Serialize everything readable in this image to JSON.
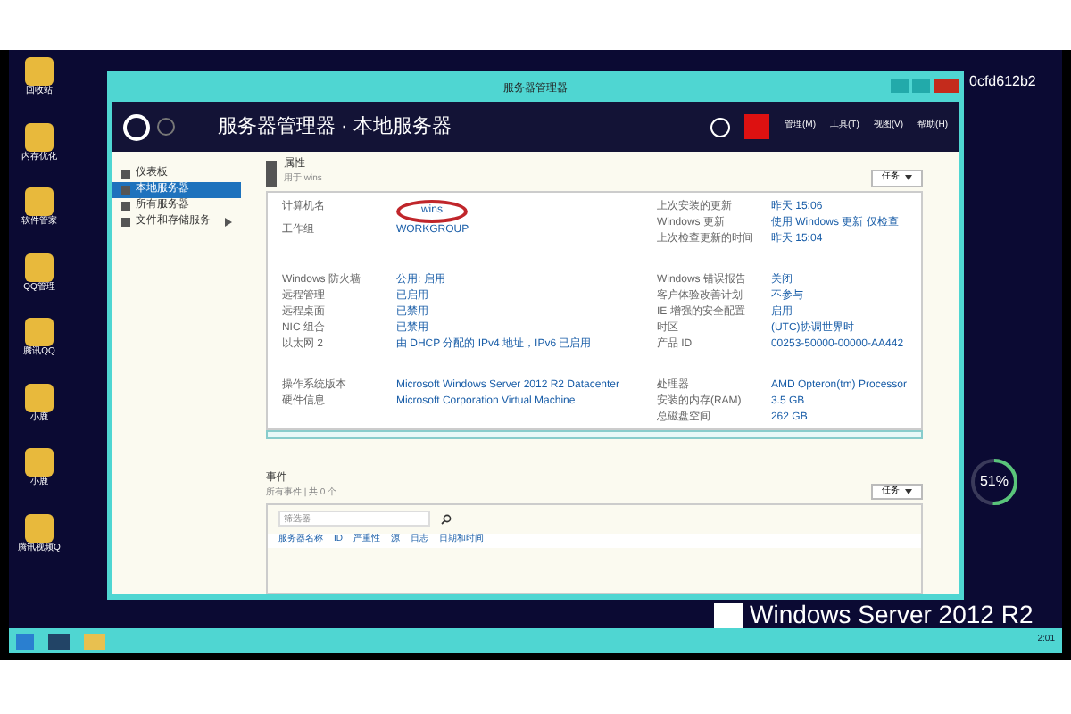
{
  "desktop_icons": [
    {
      "label": "回收站"
    },
    {
      "label": "内存优化"
    },
    {
      "label": "软件管家"
    },
    {
      "label": "QQ管理"
    },
    {
      "label": "腾讯QQ"
    },
    {
      "label": "小鹿"
    },
    {
      "label": "小鹿"
    },
    {
      "label": "腾讯视频Q"
    }
  ],
  "desktop_label": "0cfd612b2",
  "window": {
    "title": "服务器管理器"
  },
  "header": {
    "breadcrumb": "服务器管理器 · 本地服务器",
    "menu": [
      "管理(M)",
      "工具(T)",
      "视图(V)",
      "帮助(H)"
    ]
  },
  "sidebar": {
    "items": [
      {
        "label": "仪表板",
        "selected": false,
        "expandable": false
      },
      {
        "label": "本地服务器",
        "selected": true,
        "expandable": false
      },
      {
        "label": "所有服务器",
        "selected": false,
        "expandable": false
      },
      {
        "label": "文件和存储服务",
        "selected": false,
        "expandable": true
      }
    ]
  },
  "properties": {
    "title": "属性",
    "subtitle": "用于 wins",
    "tasks_button": "任务",
    "groups": [
      {
        "left": [
          {
            "label": "计算机名",
            "value": "wins",
            "highlighted": true
          },
          {
            "label": "工作组",
            "value": "WORKGROUP",
            "highlighted": false
          }
        ],
        "right": [
          {
            "label": "上次安装的更新",
            "value": "昨天 15:06"
          },
          {
            "label": "Windows 更新",
            "value": "使用 Windows 更新 仅检查"
          },
          {
            "label": "上次检查更新的时间",
            "value": "昨天 15:04"
          }
        ]
      },
      {
        "left": [
          {
            "label": "Windows 防火墙",
            "value": "公用: 启用",
            "highlighted": false
          },
          {
            "label": "远程管理",
            "value": "已启用",
            "highlighted": false
          },
          {
            "label": "远程桌面",
            "value": "已禁用",
            "highlighted": false
          },
          {
            "label": "NIC 组合",
            "value": "已禁用",
            "highlighted": false
          },
          {
            "label": "以太网 2",
            "value": "由 DHCP 分配的 IPv4 地址，IPv6 已启用",
            "highlighted": false
          }
        ],
        "right": [
          {
            "label": "Windows 错误报告",
            "value": "关闭"
          },
          {
            "label": "客户体验改善计划",
            "value": "不参与"
          },
          {
            "label": "IE 增强的安全配置",
            "value": "启用"
          },
          {
            "label": "时区",
            "value": "(UTC)协调世界时"
          },
          {
            "label": "产品 ID",
            "value": "00253-50000-00000-AA442"
          }
        ]
      },
      {
        "left": [
          {
            "label": "操作系统版本",
            "value": "Microsoft Windows Server 2012 R2 Datacenter",
            "highlighted": false
          },
          {
            "label": "硬件信息",
            "value": "Microsoft Corporation Virtual Machine",
            "highlighted": false
          }
        ],
        "right": [
          {
            "label": "处理器",
            "value": "AMD Opteron(tm) Processor"
          },
          {
            "label": "安装的内存(RAM)",
            "value": "3.5 GB"
          },
          {
            "label": "总磁盘空间",
            "value": "262 GB"
          }
        ]
      }
    ]
  },
  "events": {
    "title": "事件",
    "subtitle": "所有事件 | 共 0 个",
    "tasks_button": "任务",
    "filter": {
      "placeholder": "筛选器"
    },
    "columns": [
      "服务器名称",
      "ID",
      "严重性",
      "源",
      "日志",
      "日期和时间"
    ]
  },
  "meter": {
    "reading": "51%",
    "level": 0.51
  },
  "branding": "Windows Server 2012 R2",
  "taskbar": {
    "clock": "2:01"
  }
}
